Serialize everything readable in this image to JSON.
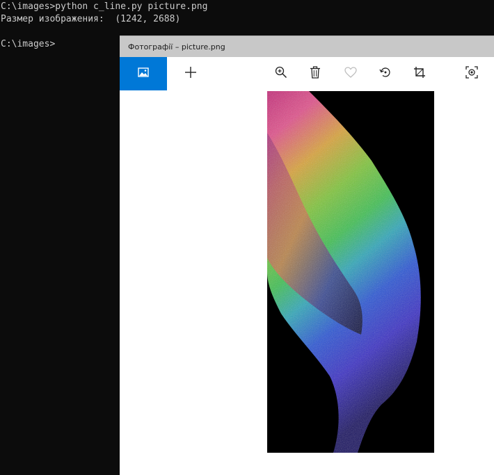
{
  "console": {
    "lines": [
      "C:\\images>python c_line.py picture.png",
      "Размер изображения:  (1242, 2688)",
      "C:\\images>"
    ]
  },
  "photos_window": {
    "title": "Фотографії – picture.png",
    "toolbar": {
      "buttons": [
        {
          "icon": "image-icon",
          "active": true
        },
        {
          "icon": "plus-icon"
        },
        {
          "icon": "zoom-in-icon"
        },
        {
          "icon": "trash-icon"
        },
        {
          "icon": "heart-icon"
        },
        {
          "icon": "rotate-icon"
        },
        {
          "icon": "crop-icon"
        },
        {
          "icon": "focus-icon"
        }
      ]
    },
    "colors": {
      "accent": "#0078d7",
      "titlebar": "#c8c8c8",
      "console_bg": "#0c0c0c",
      "console_text": "#cccccc"
    }
  }
}
